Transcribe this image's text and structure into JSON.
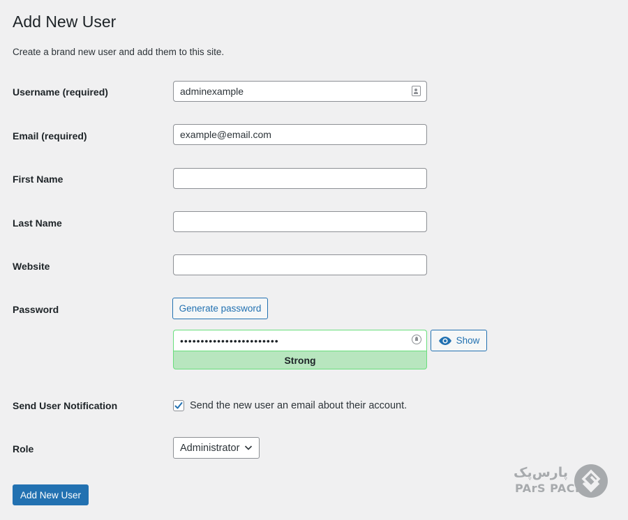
{
  "header": {
    "title": "Add New User",
    "description": "Create a brand new user and add them to this site."
  },
  "form": {
    "username": {
      "label": "Username (required)",
      "value": "adminexample",
      "icon": "contact-card-icon"
    },
    "email": {
      "label": "Email (required)",
      "value": "example@email.com"
    },
    "first_name": {
      "label": "First Name",
      "value": ""
    },
    "last_name": {
      "label": "Last Name",
      "value": ""
    },
    "website": {
      "label": "Website",
      "value": ""
    },
    "password": {
      "label": "Password",
      "generate_label": "Generate password",
      "value": "••••••••••••••••••••••••",
      "strength": "Strong",
      "show_label": "Show",
      "strength_color": "#b8e6bf"
    },
    "notification": {
      "label": "Send User Notification",
      "checked": true,
      "text": "Send the new user an email about their account."
    },
    "role": {
      "label": "Role",
      "selected": "Administrator"
    },
    "submit_label": "Add New User"
  },
  "watermark": {
    "text_fa": "پارس‌پک",
    "text_en": "PArS PACK"
  },
  "colors": {
    "accent": "#2271b1",
    "background": "#f0f0f1",
    "strong": "#68de7c"
  }
}
